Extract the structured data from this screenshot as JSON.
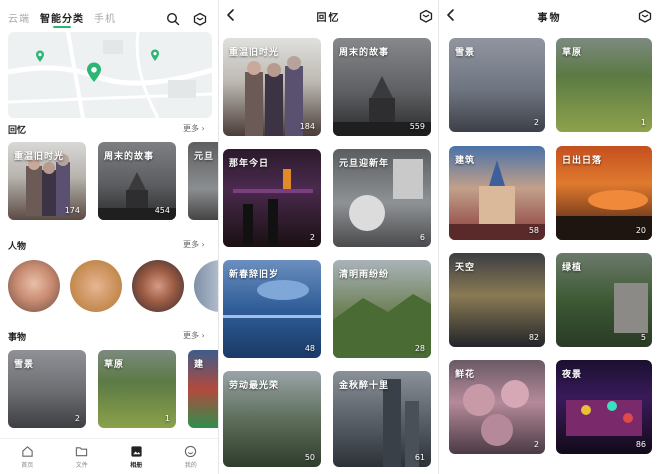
{
  "left": {
    "tabs": [
      "云端",
      "智能分类",
      "手机"
    ],
    "sections": {
      "memories": {
        "title": "回忆",
        "more": "更多 ›"
      },
      "people": {
        "title": "人物",
        "more": "更多 ›"
      },
      "things": {
        "title": "事物",
        "more": "更多 ›"
      }
    },
    "memories": [
      {
        "label": "重温旧时光",
        "count": "174"
      },
      {
        "label": "周末的故事",
        "count": "454"
      },
      {
        "label": "元旦",
        "count": ""
      }
    ],
    "things": [
      {
        "label": "雪景",
        "count": "2"
      },
      {
        "label": "草原",
        "count": "1"
      },
      {
        "label": "建",
        "count": ""
      }
    ],
    "nav": [
      "首页",
      "文件",
      "相册",
      "我的"
    ]
  },
  "memories_page": {
    "title": "回忆",
    "albums": [
      {
        "label": "重温旧时光",
        "count": "184"
      },
      {
        "label": "周末的故事",
        "count": "559"
      },
      {
        "label": "那年今日",
        "count": "2"
      },
      {
        "label": "元旦迎新年",
        "count": "6"
      },
      {
        "label": "新春辞旧岁",
        "count": "48"
      },
      {
        "label": "清明雨纷纷",
        "count": "28"
      },
      {
        "label": "劳动最光荣",
        "count": "50"
      },
      {
        "label": "金秋醉十里",
        "count": "61"
      }
    ]
  },
  "things_page": {
    "title": "事物",
    "albums": [
      {
        "label": "雪景",
        "count": "2"
      },
      {
        "label": "草原",
        "count": "1"
      },
      {
        "label": "建筑",
        "count": "58"
      },
      {
        "label": "日出日落",
        "count": "20"
      },
      {
        "label": "天空",
        "count": "82"
      },
      {
        "label": "绿植",
        "count": "5"
      },
      {
        "label": "鲜花",
        "count": "2"
      },
      {
        "label": "夜景",
        "count": "86"
      }
    ]
  },
  "colors": {
    "accent": "#2bb673"
  }
}
